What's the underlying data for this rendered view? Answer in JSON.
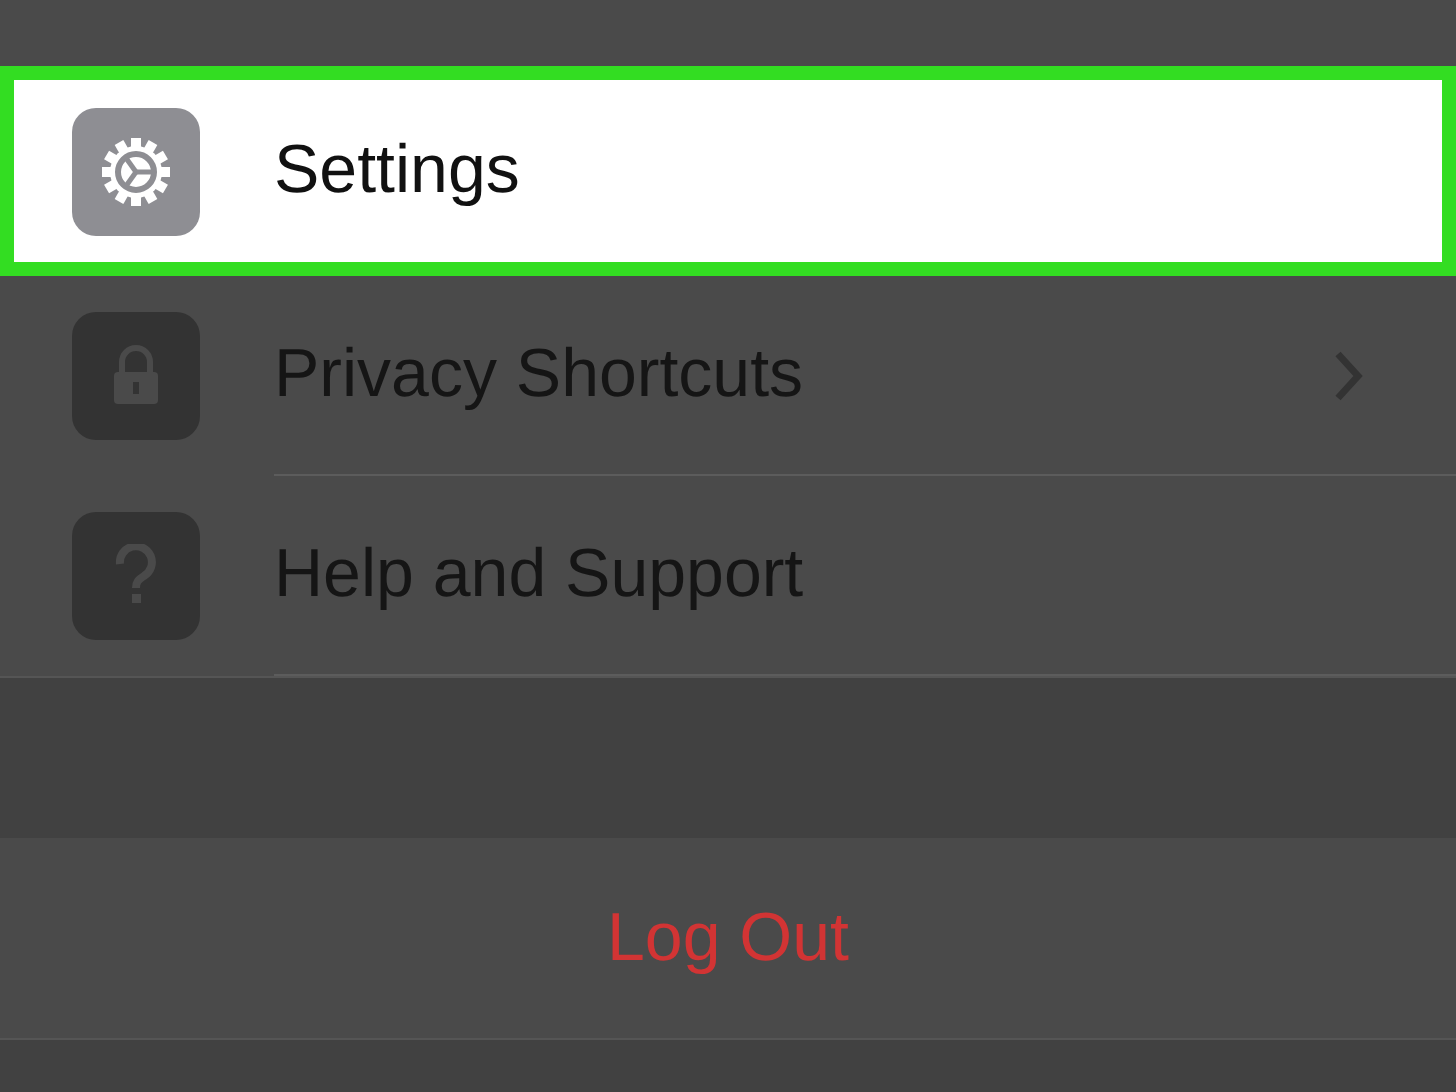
{
  "menu": {
    "items": [
      {
        "label": "Settings",
        "kind": "gear",
        "highlighted": true,
        "disclosure": false
      },
      {
        "label": "Privacy Shortcuts",
        "kind": "lock",
        "highlighted": false,
        "disclosure": true
      },
      {
        "label": "Help and Support",
        "kind": "question",
        "highlighted": false,
        "disclosure": false
      }
    ]
  },
  "logout": {
    "label": "Log Out"
  }
}
